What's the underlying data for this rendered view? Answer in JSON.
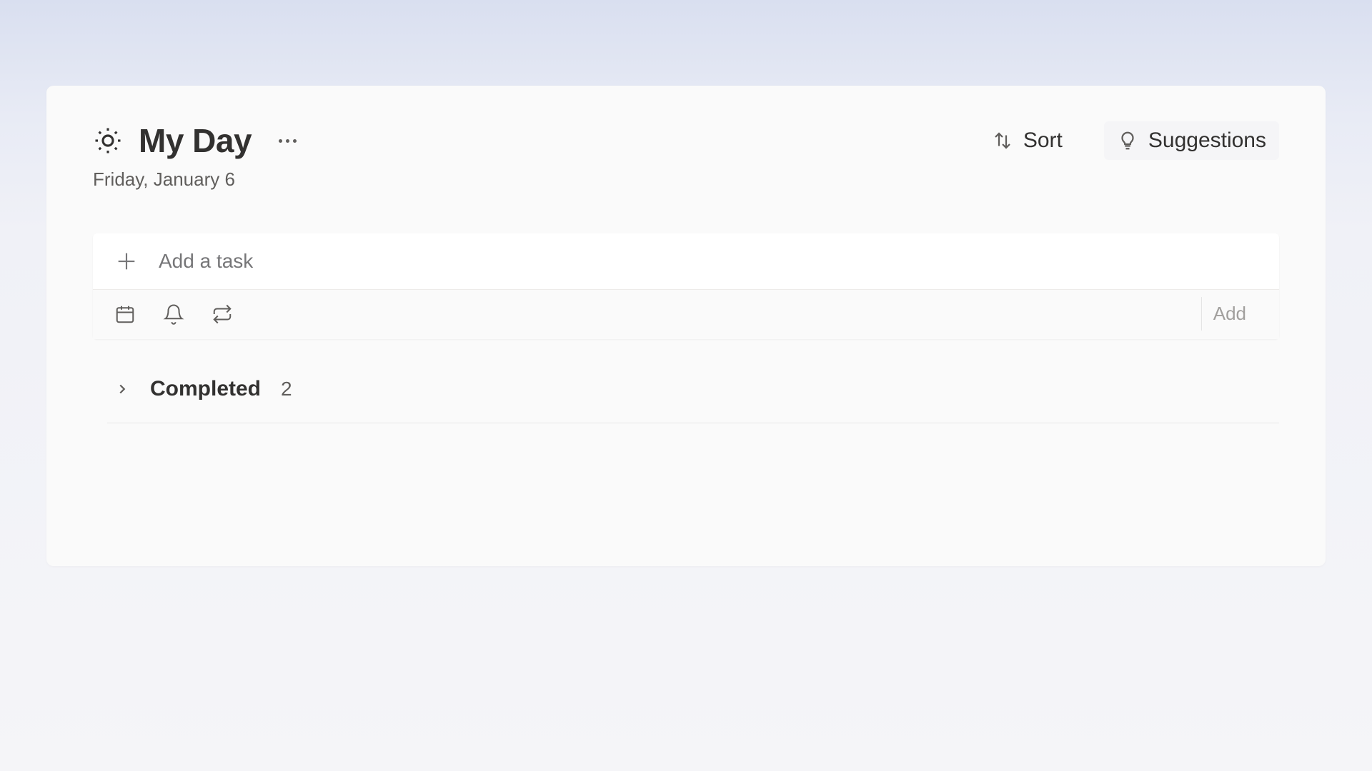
{
  "header": {
    "title": "My Day",
    "date": "Friday, January 6",
    "sort_label": "Sort",
    "suggestions_label": "Suggestions"
  },
  "task_input": {
    "placeholder": "Add a task",
    "add_button": "Add"
  },
  "completed": {
    "label": "Completed",
    "count": "2"
  }
}
